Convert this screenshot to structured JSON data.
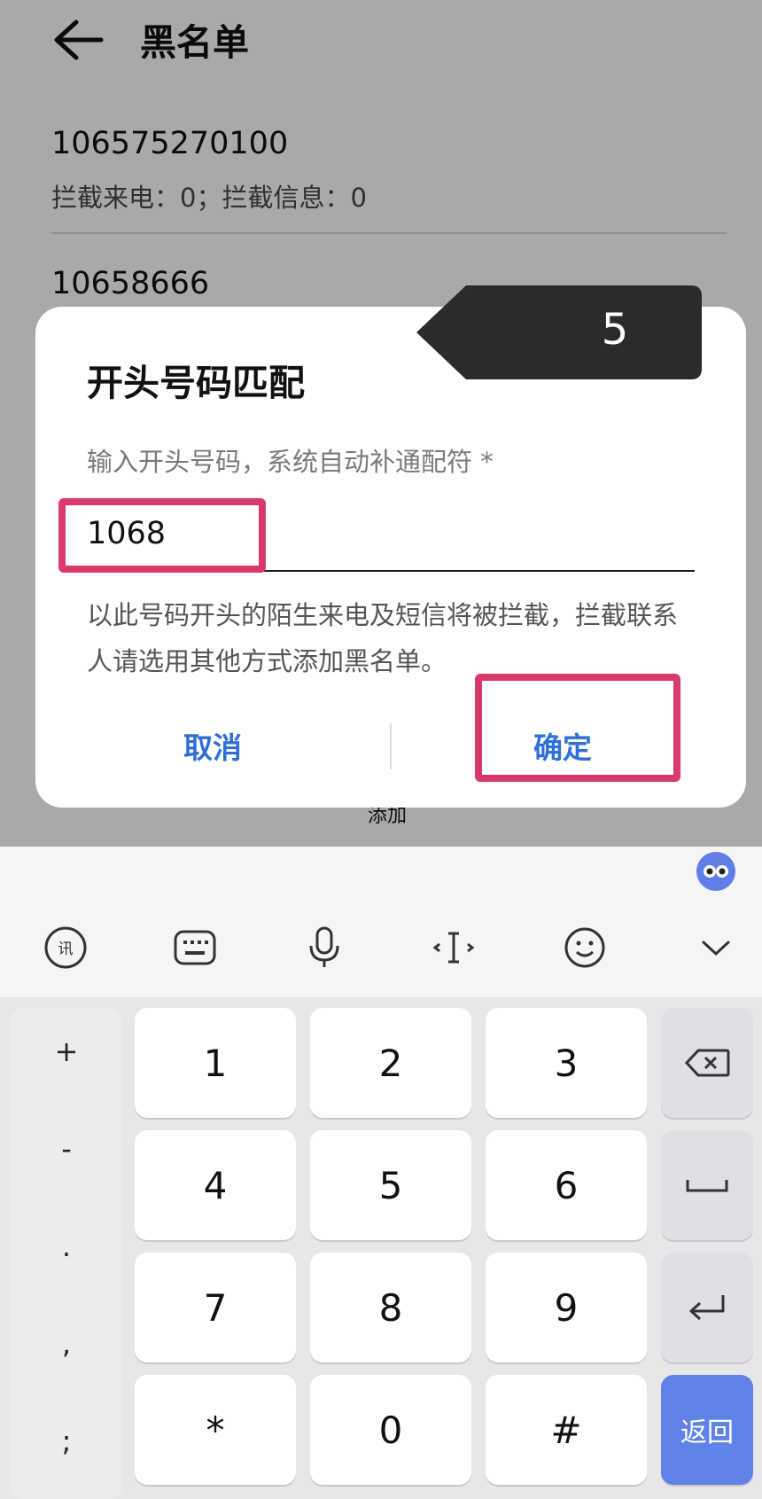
{
  "header": {
    "title": "黑名单"
  },
  "blacklist": [
    {
      "number": "106575270100",
      "stats": "拦截来电：0；拦截信息：0"
    },
    {
      "number": "10658666"
    }
  ],
  "background": {
    "add_label": "添加"
  },
  "dialog": {
    "title": "开头号码匹配",
    "hint": "输入开头号码，系统自动补通配符 *",
    "input_value": "1068",
    "description": "以此号码开头的陌生来电及短信将被拦截，拦截联系人请选用其他方式添加黑名单。",
    "cancel_label": "取消",
    "confirm_label": "确定"
  },
  "step_badge": {
    "number": "5"
  },
  "keyboard": {
    "toolbar_icons": [
      "voice-ai-icon",
      "keyboard-icon",
      "microphone-icon",
      "cursor-move-icon",
      "emoji-icon",
      "collapse-icon"
    ],
    "symbols": [
      "+",
      "-",
      ".",
      ",",
      ";"
    ],
    "keys": [
      "1",
      "2",
      "3",
      "4",
      "5",
      "6",
      "7",
      "8",
      "9",
      "*",
      "0",
      "#"
    ],
    "return_label": "返回"
  },
  "colors": {
    "accent": "#2f6fd6",
    "highlight": "#d93a6a",
    "action_key": "#5f82e8"
  }
}
